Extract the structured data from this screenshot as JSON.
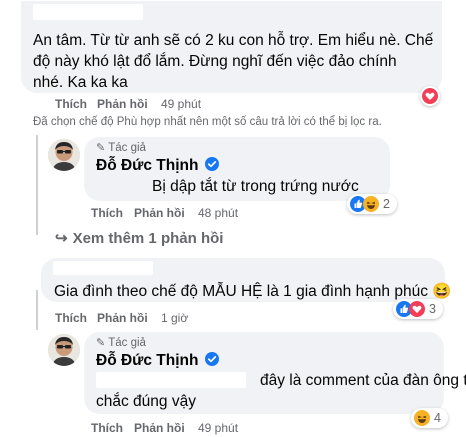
{
  "comment1": {
    "text_line1": "An tâm. Từ từ anh sẽ có 2 ku con hỗ trợ. Em hiểu nè. Chế",
    "text_line2": "độ này khó lật đổ lắm. Đừng nghĩ đến việc đảo chính",
    "text_line3": "nhé. Ka ka ka",
    "like_label": "Thích",
    "reply_label": "Phản hồi",
    "time": "49 phút",
    "reaction_icon": "heart-icon"
  },
  "filter_note": "Đã chọn chế độ Phù hợp nhất nên một số câu trả lời có thể bị lọc ra.",
  "reply1": {
    "author_badge": "Tác giả",
    "author_name": "Đỗ Đức Thịnh",
    "text": "Bị dập tắt từ trong trứng nước",
    "like_label": "Thích",
    "reply_label": "Phản hồi",
    "time": "48 phút",
    "reaction_count": "2",
    "reaction_icons": [
      "like-icon",
      "haha-icon"
    ]
  },
  "see_more_label": "Xem thêm 1 phản hồi",
  "comment2": {
    "text": "Gia đình theo chế độ MẪU HỆ là 1 gia đình hạnh phúc 😆",
    "like_label": "Thích",
    "reply_label": "Phản hồi",
    "time": "1 giờ",
    "reaction_count": "3",
    "reaction_icons": [
      "like-icon",
      "heart-icon"
    ]
  },
  "reply2": {
    "author_badge": "Tác giả",
    "author_name": "Đỗ Đức Thịnh",
    "text_line1": "đây là comment của đàn ông thì",
    "text_line2": "chắc đúng vậy",
    "like_label": "Thích",
    "reply_label": "Phản hồi",
    "time": "49 phút",
    "reaction_count": "4",
    "reaction_icons": [
      "haha-icon"
    ]
  },
  "colors": {
    "bubble": "#f0f2f5",
    "secondary_text": "#65676b",
    "like_blue": "#1877f2",
    "heart_red": "#f33e58",
    "haha_yellow": "#f7b125"
  }
}
